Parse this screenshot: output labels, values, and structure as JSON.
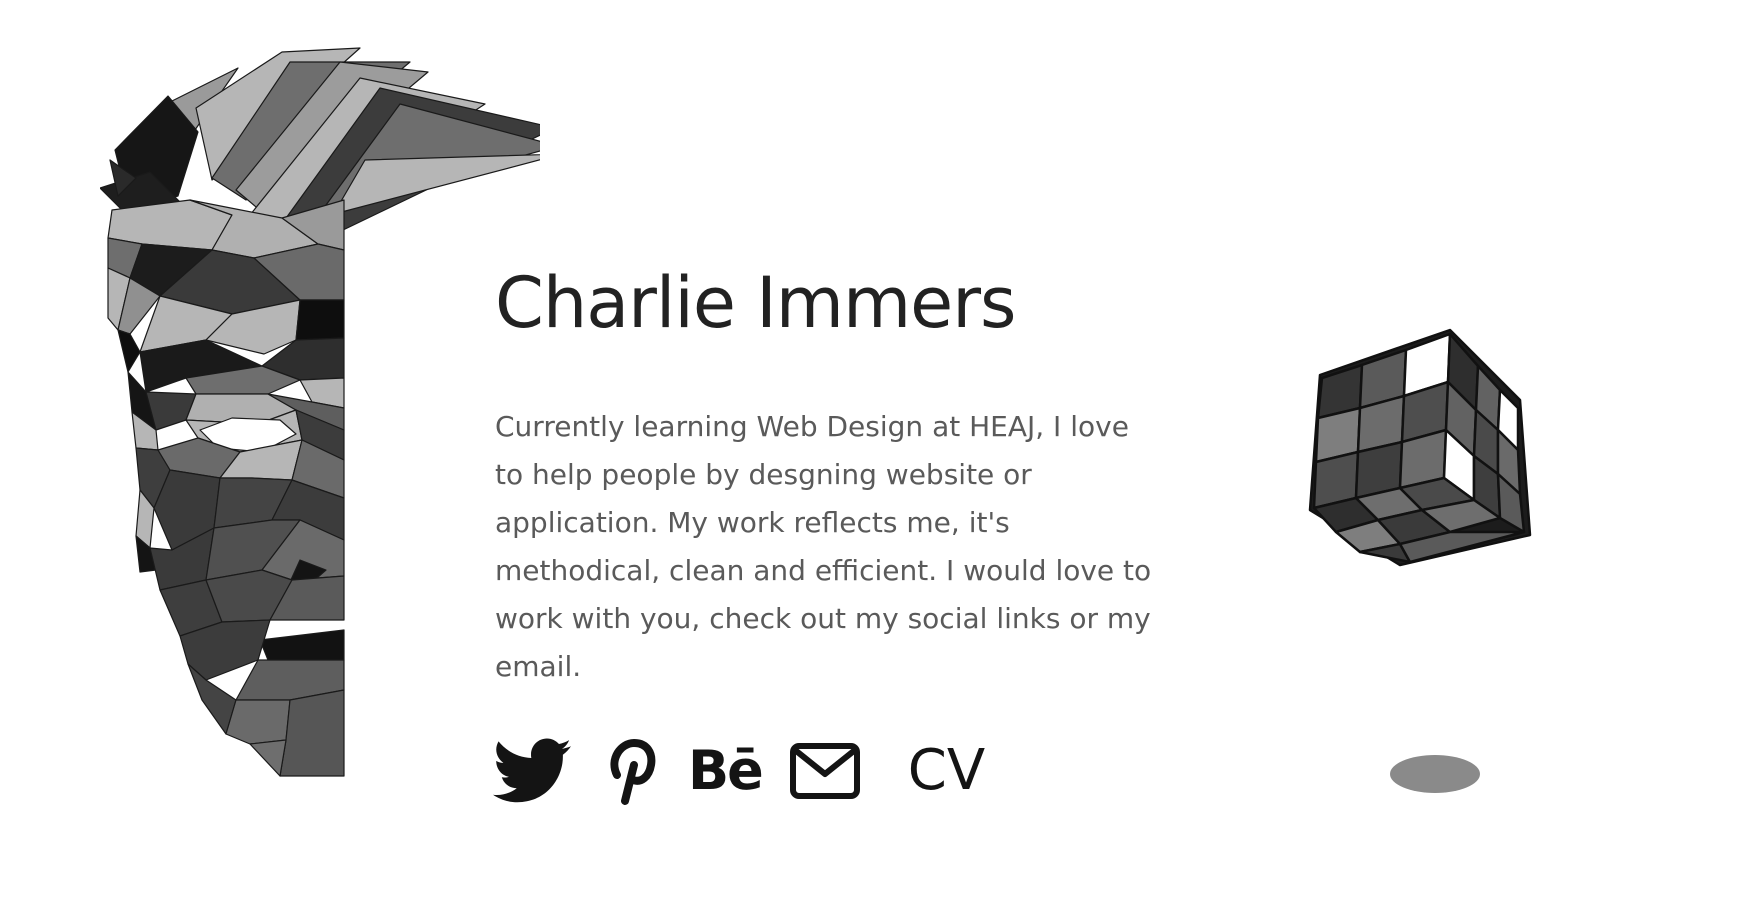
{
  "profile": {
    "name": "Charlie Immers",
    "bio": "Currently learning Web Design at HEAJ, I love to help people by desgning website or application. My work reflects me, it's methodical, clean and efficient. I would love to work with you, check out my social links or my email."
  },
  "socials": {
    "twitter_icon": "twitter-bird-icon",
    "pinterest_icon": "pinterest-p-icon",
    "behance_label": "Bē",
    "email_icon": "envelope-icon",
    "cv_label": "CV"
  },
  "colors": {
    "text_dark": "#222222",
    "text_body": "#5a5a5a",
    "icon": "#141414",
    "shadow": "#8a8a8a",
    "background": "#ffffff"
  }
}
